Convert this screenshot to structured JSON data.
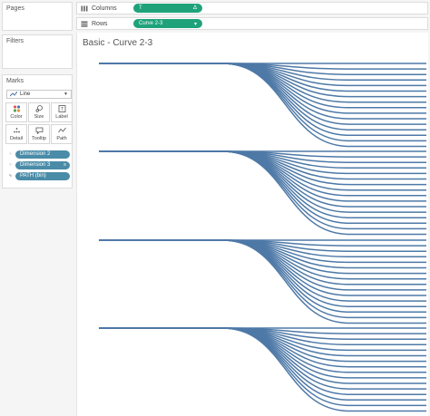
{
  "panels": {
    "pages_label": "Pages",
    "filters_label": "Filters",
    "marks_label": "Marks",
    "mark_type": "Line",
    "buttons": [
      "Color",
      "Size",
      "Label",
      "Detail",
      "Tooltip",
      "Path"
    ],
    "pills": [
      {
        "name": "Dimension 2",
        "icon": "detail-icon"
      },
      {
        "name": "Dimension 3",
        "icon": "detail-icon",
        "sorted": true
      },
      {
        "name": "PATH (bin)",
        "icon": "path-icon"
      }
    ]
  },
  "shelves": {
    "columns_label": "Columns",
    "columns_pill": "T",
    "columns_pill_suffix": "Δ",
    "rows_label": "Rows",
    "rows_pill": "Curve 2-3",
    "rows_pill_suffix": "▾"
  },
  "sheet_title": "Basic - Curve 2-3",
  "chart_data": {
    "type": "line",
    "groups": 4,
    "lines_per_group": 16,
    "color": "#4e79a7",
    "description": "sigmoid curves fanning from a single point downward"
  }
}
